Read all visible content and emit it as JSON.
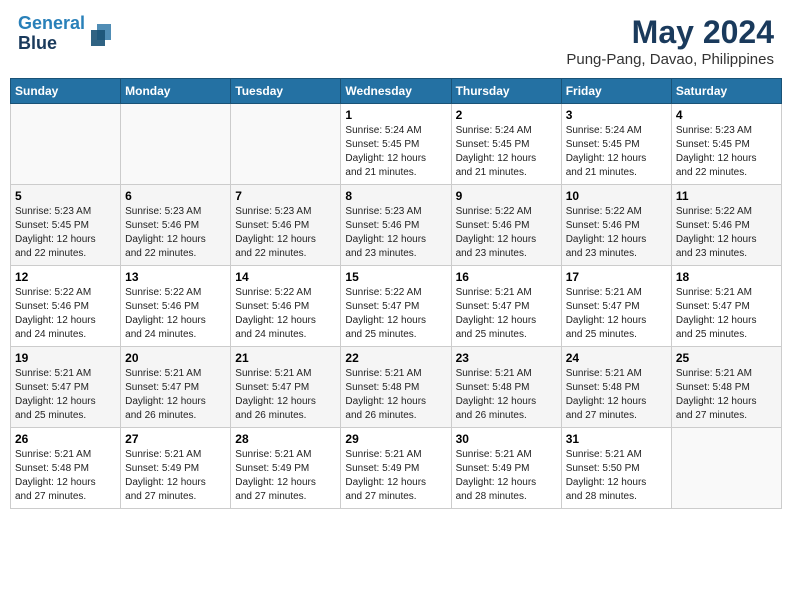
{
  "header": {
    "logo_line1": "General",
    "logo_line2": "Blue",
    "month": "May 2024",
    "location": "Pung-Pang, Davao, Philippines"
  },
  "weekdays": [
    "Sunday",
    "Monday",
    "Tuesday",
    "Wednesday",
    "Thursday",
    "Friday",
    "Saturday"
  ],
  "weeks": [
    [
      {
        "day": "",
        "info": ""
      },
      {
        "day": "",
        "info": ""
      },
      {
        "day": "",
        "info": ""
      },
      {
        "day": "1",
        "info": "Sunrise: 5:24 AM\nSunset: 5:45 PM\nDaylight: 12 hours\nand 21 minutes."
      },
      {
        "day": "2",
        "info": "Sunrise: 5:24 AM\nSunset: 5:45 PM\nDaylight: 12 hours\nand 21 minutes."
      },
      {
        "day": "3",
        "info": "Sunrise: 5:24 AM\nSunset: 5:45 PM\nDaylight: 12 hours\nand 21 minutes."
      },
      {
        "day": "4",
        "info": "Sunrise: 5:23 AM\nSunset: 5:45 PM\nDaylight: 12 hours\nand 22 minutes."
      }
    ],
    [
      {
        "day": "5",
        "info": "Sunrise: 5:23 AM\nSunset: 5:45 PM\nDaylight: 12 hours\nand 22 minutes."
      },
      {
        "day": "6",
        "info": "Sunrise: 5:23 AM\nSunset: 5:46 PM\nDaylight: 12 hours\nand 22 minutes."
      },
      {
        "day": "7",
        "info": "Sunrise: 5:23 AM\nSunset: 5:46 PM\nDaylight: 12 hours\nand 22 minutes."
      },
      {
        "day": "8",
        "info": "Sunrise: 5:23 AM\nSunset: 5:46 PM\nDaylight: 12 hours\nand 23 minutes."
      },
      {
        "day": "9",
        "info": "Sunrise: 5:22 AM\nSunset: 5:46 PM\nDaylight: 12 hours\nand 23 minutes."
      },
      {
        "day": "10",
        "info": "Sunrise: 5:22 AM\nSunset: 5:46 PM\nDaylight: 12 hours\nand 23 minutes."
      },
      {
        "day": "11",
        "info": "Sunrise: 5:22 AM\nSunset: 5:46 PM\nDaylight: 12 hours\nand 23 minutes."
      }
    ],
    [
      {
        "day": "12",
        "info": "Sunrise: 5:22 AM\nSunset: 5:46 PM\nDaylight: 12 hours\nand 24 minutes."
      },
      {
        "day": "13",
        "info": "Sunrise: 5:22 AM\nSunset: 5:46 PM\nDaylight: 12 hours\nand 24 minutes."
      },
      {
        "day": "14",
        "info": "Sunrise: 5:22 AM\nSunset: 5:46 PM\nDaylight: 12 hours\nand 24 minutes."
      },
      {
        "day": "15",
        "info": "Sunrise: 5:22 AM\nSunset: 5:47 PM\nDaylight: 12 hours\nand 25 minutes."
      },
      {
        "day": "16",
        "info": "Sunrise: 5:21 AM\nSunset: 5:47 PM\nDaylight: 12 hours\nand 25 minutes."
      },
      {
        "day": "17",
        "info": "Sunrise: 5:21 AM\nSunset: 5:47 PM\nDaylight: 12 hours\nand 25 minutes."
      },
      {
        "day": "18",
        "info": "Sunrise: 5:21 AM\nSunset: 5:47 PM\nDaylight: 12 hours\nand 25 minutes."
      }
    ],
    [
      {
        "day": "19",
        "info": "Sunrise: 5:21 AM\nSunset: 5:47 PM\nDaylight: 12 hours\nand 25 minutes."
      },
      {
        "day": "20",
        "info": "Sunrise: 5:21 AM\nSunset: 5:47 PM\nDaylight: 12 hours\nand 26 minutes."
      },
      {
        "day": "21",
        "info": "Sunrise: 5:21 AM\nSunset: 5:47 PM\nDaylight: 12 hours\nand 26 minutes."
      },
      {
        "day": "22",
        "info": "Sunrise: 5:21 AM\nSunset: 5:48 PM\nDaylight: 12 hours\nand 26 minutes."
      },
      {
        "day": "23",
        "info": "Sunrise: 5:21 AM\nSunset: 5:48 PM\nDaylight: 12 hours\nand 26 minutes."
      },
      {
        "day": "24",
        "info": "Sunrise: 5:21 AM\nSunset: 5:48 PM\nDaylight: 12 hours\nand 27 minutes."
      },
      {
        "day": "25",
        "info": "Sunrise: 5:21 AM\nSunset: 5:48 PM\nDaylight: 12 hours\nand 27 minutes."
      }
    ],
    [
      {
        "day": "26",
        "info": "Sunrise: 5:21 AM\nSunset: 5:48 PM\nDaylight: 12 hours\nand 27 minutes."
      },
      {
        "day": "27",
        "info": "Sunrise: 5:21 AM\nSunset: 5:49 PM\nDaylight: 12 hours\nand 27 minutes."
      },
      {
        "day": "28",
        "info": "Sunrise: 5:21 AM\nSunset: 5:49 PM\nDaylight: 12 hours\nand 27 minutes."
      },
      {
        "day": "29",
        "info": "Sunrise: 5:21 AM\nSunset: 5:49 PM\nDaylight: 12 hours\nand 27 minutes."
      },
      {
        "day": "30",
        "info": "Sunrise: 5:21 AM\nSunset: 5:49 PM\nDaylight: 12 hours\nand 28 minutes."
      },
      {
        "day": "31",
        "info": "Sunrise: 5:21 AM\nSunset: 5:50 PM\nDaylight: 12 hours\nand 28 minutes."
      },
      {
        "day": "",
        "info": ""
      }
    ]
  ]
}
